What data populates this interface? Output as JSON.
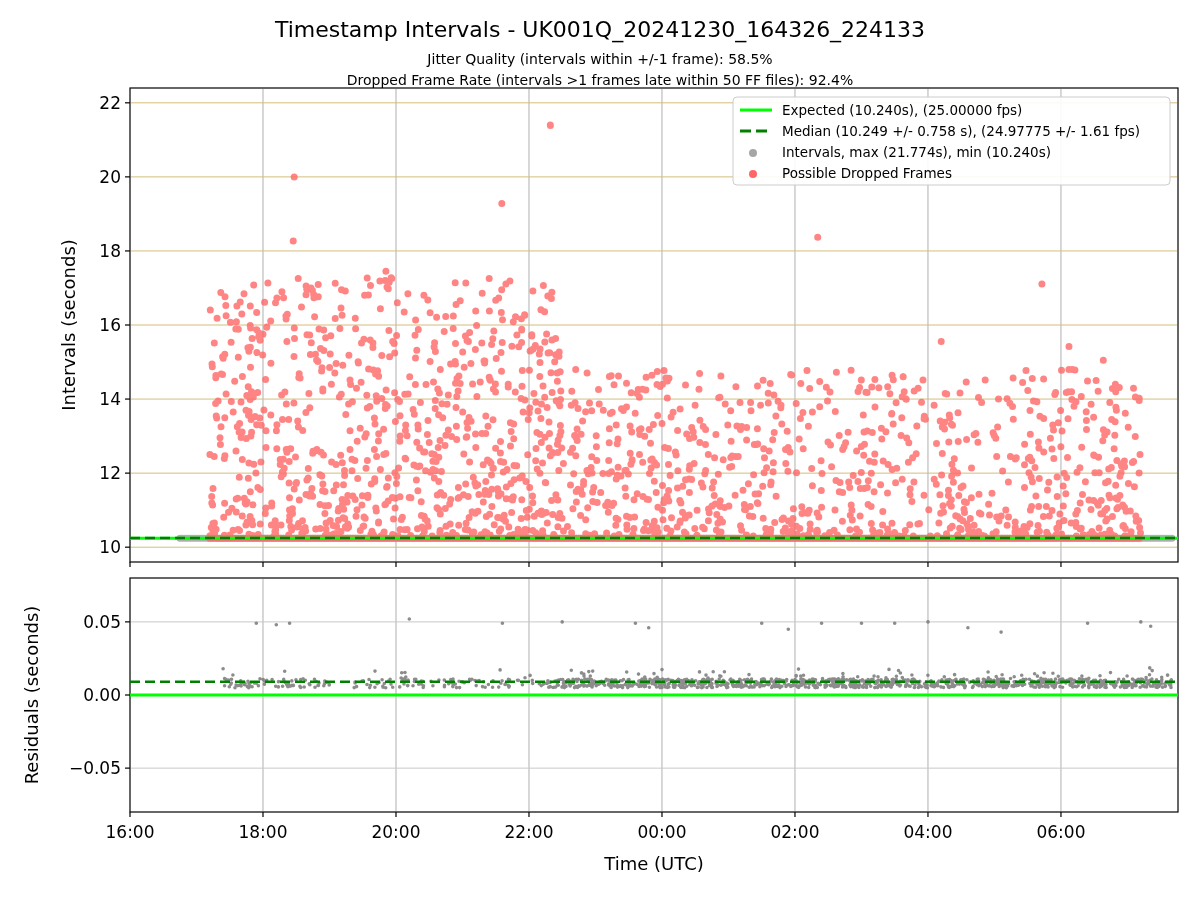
{
  "figure": {
    "title": "Timestamp Intervals - UK001Q_20241230_164326_224133",
    "subtitles": [
      "Jitter Quality (intervals within +/-1 frame): 58.5%",
      "Dropped Frame Rate (intervals >1 frames late within 50 FF files): 92.4%"
    ]
  },
  "intervals_plot": {
    "y_axis_label": "Intervals (seconds)",
    "y_tick_labels": [
      "22",
      "20",
      "18",
      "16",
      "14",
      "12",
      "10"
    ],
    "legend": [
      {
        "label": "Expected (10.240s), (25.00000 fps)",
        "color": "#00ff00",
        "kind": "line"
      },
      {
        "label": "Median (10.249 +/- 0.758 s), (24.97775 +/- 1.61 fps)",
        "color": "#008000",
        "kind": "dashed"
      },
      {
        "label": "Intervals, max (21.774s), min (10.240s)",
        "color": "#a6a6a6",
        "kind": "marker"
      },
      {
        "label": "Possible Dropped Frames",
        "color": "#ff6666",
        "kind": "marker"
      }
    ]
  },
  "residuals_plot": {
    "y_axis_label": "Residuals (seconds)",
    "y_tick_labels": [
      "0.05",
      "0.00",
      "−0.05"
    ],
    "x_tick_labels": [
      "16:00",
      "18:00",
      "20:00",
      "22:00",
      "00:00",
      "02:00",
      "04:00",
      "06:00"
    ],
    "x_axis_label": "Time (UTC)"
  }
}
